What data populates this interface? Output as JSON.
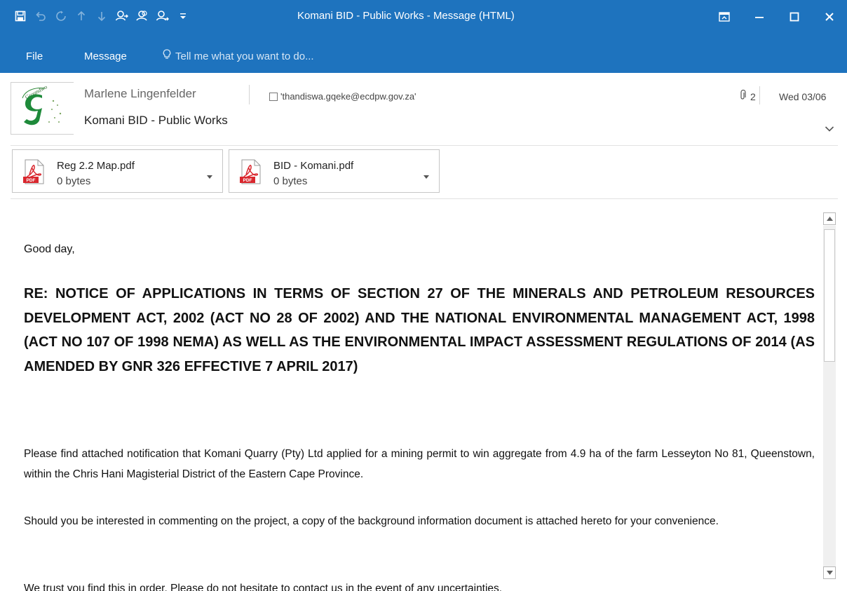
{
  "window": {
    "title": "Komani BID - Public Works - Message (HTML)"
  },
  "ribbon": {
    "tabs": [
      "File",
      "Message"
    ],
    "tell_me": "Tell me what you want to do..."
  },
  "message": {
    "sender": "Marlene Lingenfelder",
    "recipient": "'thandiswa.gqeke@ecdpw.gov.za'",
    "subject": "Komani BID - Public Works",
    "attachment_count": "2",
    "date": "Wed 03/06"
  },
  "attachments": [
    {
      "name": "Reg 2.2 Map.pdf",
      "size": "0 bytes",
      "icon": "pdf-icon"
    },
    {
      "name": "BID - Komani.pdf",
      "size": "0 bytes",
      "icon": "pdf-icon"
    }
  ],
  "body": {
    "greeting": "Good day,",
    "heading": "RE: NOTICE OF APPLICATIONS IN TERMS OF SECTION 27 OF THE MINERALS AND PETROLEUM RESOURCES DEVELOPMENT ACT, 2002 (ACT NO 28 OF 2002) AND THE NATIONAL ENVIRONMENTAL MANAGEMENT ACT, 1998 (ACT NO 107 OF 1998 NEMA) AS WELL AS THE ENVIRONMENTAL IMPACT ASSESSMENT REGULATIONS OF 2014 (AS AMENDED BY GNR 326 EFFECTIVE 7 APRIL 2017)",
    "paragraphs": [
      "Please find attached notification that Komani Quarry (Pty) Ltd applied for a mining permit to win aggregate from 4.9 ha of the farm Lesseyton No 81, Queenstown, within the Chris Hani Magisterial District of the Eastern Cape Province.",
      "Should you be interested in commenting on the project, a copy of the background information document is attached hereto for your convenience.",
      "We trust you find this in order. Please do not hesitate to contact us in the event of any uncertainties."
    ]
  },
  "colors": {
    "accent": "#1e73be",
    "pdf_red": "#d9272e"
  }
}
